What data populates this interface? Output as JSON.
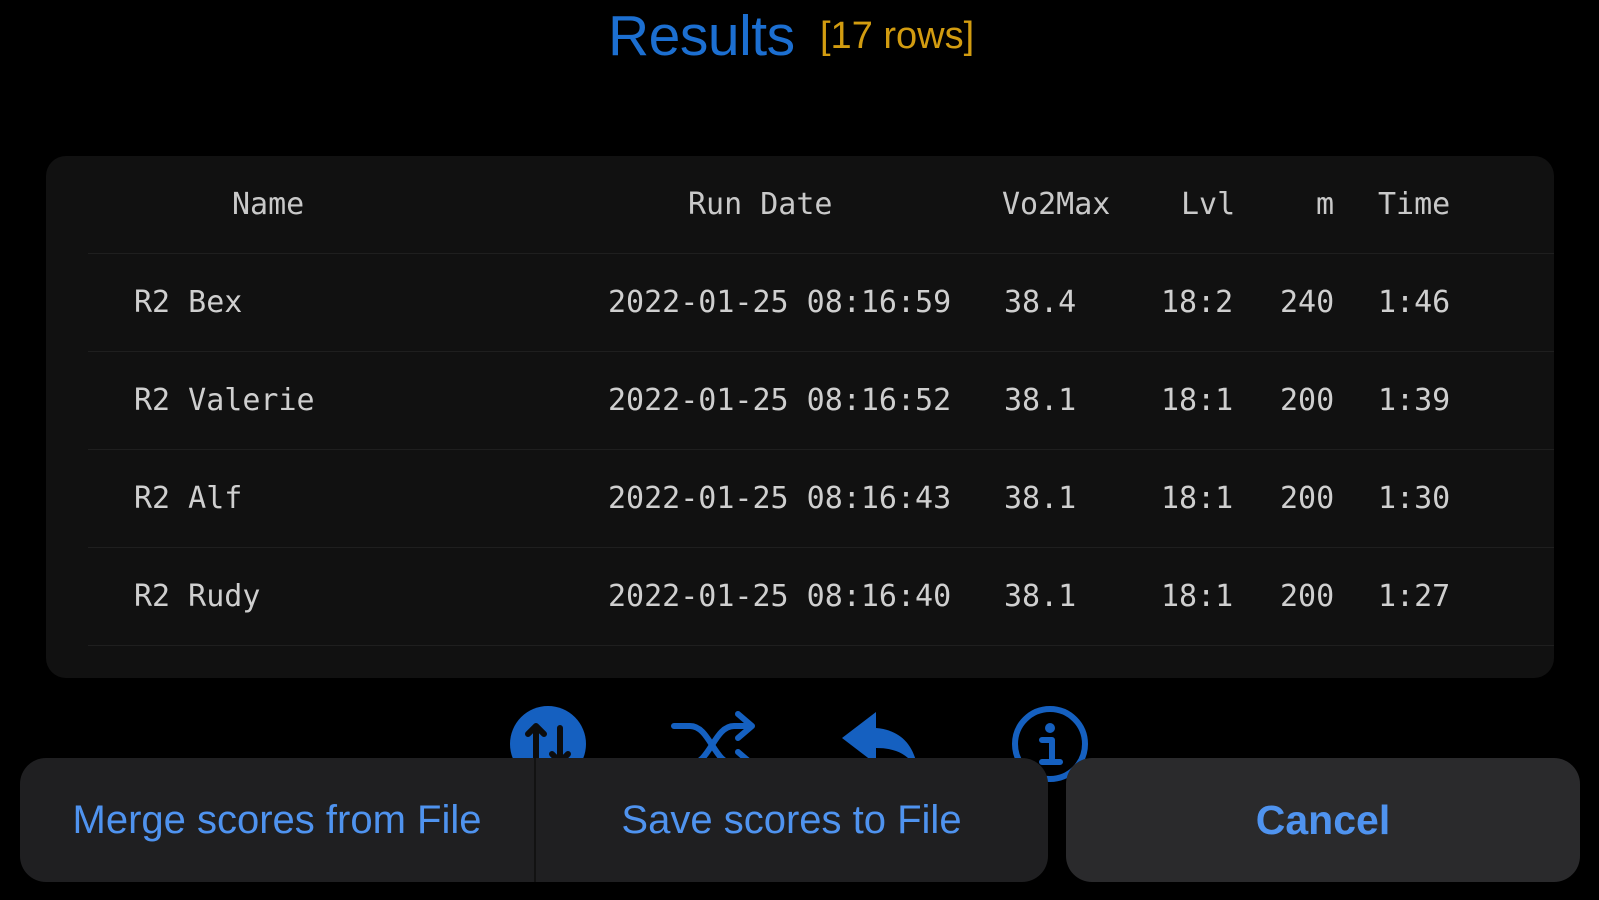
{
  "header": {
    "title": "Results",
    "row_count_label": "[17 rows]"
  },
  "table": {
    "columns": {
      "name": "Name",
      "run_date": "Run Date",
      "vo2max": "Vo2Max",
      "lvl": "Lvl",
      "m": "m",
      "time": "Time"
    },
    "rows": [
      {
        "name": "R2 Bex",
        "run_date": "2022-01-25 08:16:59",
        "vo2max": "38.4",
        "lvl": "18:2",
        "m": "240",
        "time": "1:46"
      },
      {
        "name": "R2 Valerie",
        "run_date": "2022-01-25 08:16:52",
        "vo2max": "38.1",
        "lvl": "18:1",
        "m": "200",
        "time": "1:39"
      },
      {
        "name": "R2 Alf",
        "run_date": "2022-01-25 08:16:43",
        "vo2max": "38.1",
        "lvl": "18:1",
        "m": "200",
        "time": "1:30"
      },
      {
        "name": "R2 Rudy",
        "run_date": "2022-01-25 08:16:40",
        "vo2max": "38.1",
        "lvl": "18:1",
        "m": "200",
        "time": "1:27"
      }
    ]
  },
  "toolbar": {
    "icons": [
      "sort-icon",
      "shuffle-icon",
      "undo-icon",
      "info-icon"
    ]
  },
  "action_sheet": {
    "merge_label": "Merge scores from File",
    "save_label": "Save scores to File",
    "cancel_label": "Cancel"
  },
  "colors": {
    "title": "#1c6fd1",
    "row_count": "#d29c10",
    "action": "#4f93ef",
    "icon": "#1560c0"
  }
}
